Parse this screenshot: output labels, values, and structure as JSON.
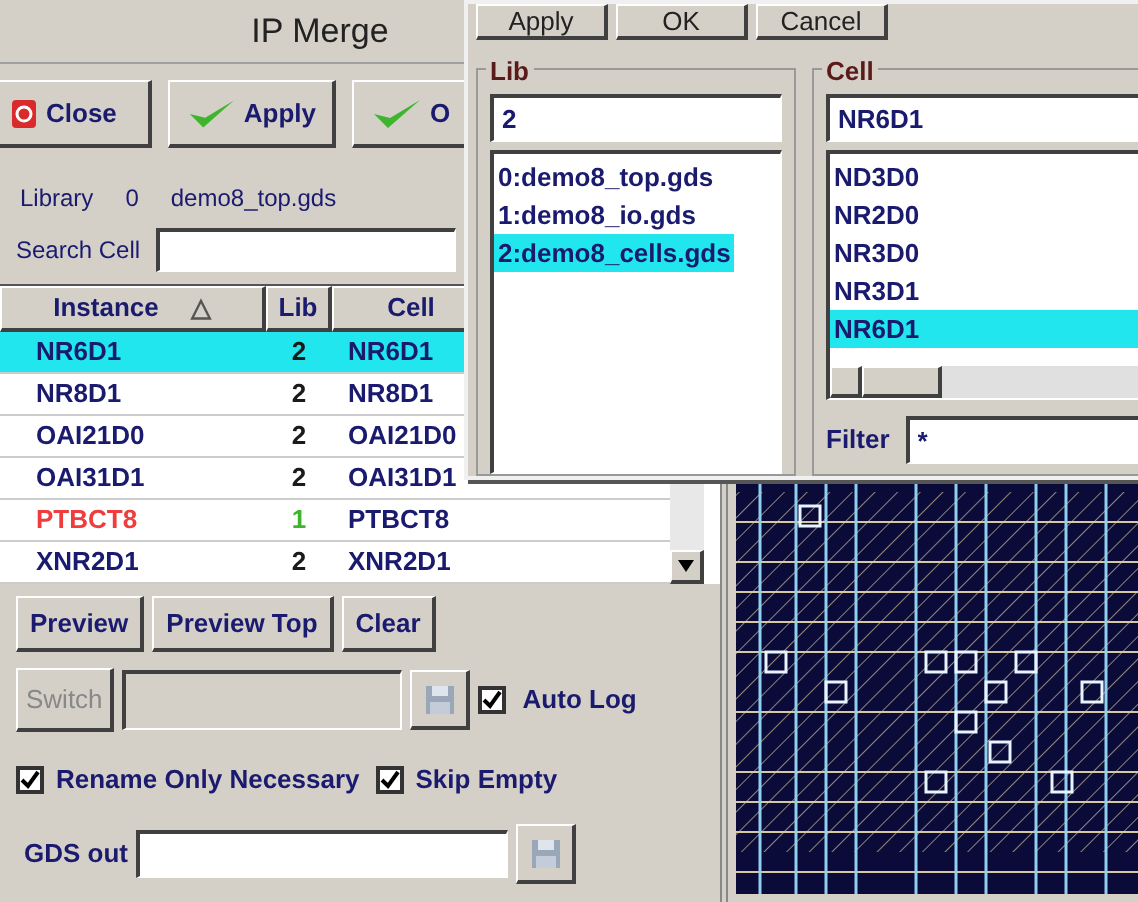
{
  "window": {
    "title": "IP Merge"
  },
  "toolbar": [
    {
      "label": "Close",
      "kind": "close"
    },
    {
      "label": "Apply",
      "kind": "confirm"
    },
    {
      "label": "O",
      "kind": "confirm"
    }
  ],
  "library": {
    "label": "Library",
    "index": "0",
    "file": "demo8_top.gds"
  },
  "search": {
    "label": "Search Cell"
  },
  "table": {
    "columns": [
      {
        "label": "Instance",
        "sort": "△"
      },
      {
        "label": "Lib"
      },
      {
        "label": "Cell"
      }
    ],
    "rows": [
      {
        "instance": "NR6D1",
        "lib": "2",
        "cell": "NR6D1",
        "selected": true,
        "kind": "normal"
      },
      {
        "instance": "NR8D1",
        "lib": "2",
        "cell": "NR8D1",
        "selected": false,
        "kind": "normal"
      },
      {
        "instance": "OAI21D0",
        "lib": "2",
        "cell": "OAI21D0",
        "selected": false,
        "kind": "normal"
      },
      {
        "instance": "OAI31D1",
        "lib": "2",
        "cell": "OAI31D1",
        "selected": false,
        "kind": "normal"
      },
      {
        "instance": "PTBCT8",
        "lib": "1",
        "cell": "PTBCT8",
        "selected": false,
        "kind": "io"
      },
      {
        "instance": "XNR2D1",
        "lib": "2",
        "cell": "XNR2D1",
        "selected": false,
        "kind": "normal"
      }
    ]
  },
  "preview_buttons": [
    "Preview",
    "Preview Top",
    "Clear"
  ],
  "switch": {
    "label": "Switch",
    "disabled": true
  },
  "auto_log": {
    "label": "Auto Log",
    "checked": true
  },
  "options": [
    {
      "label": "Rename Only Necessary",
      "checked": true
    },
    {
      "label": "Skip Empty",
      "checked": true
    }
  ],
  "gds_out": {
    "label": "GDS out"
  },
  "dialog": {
    "buttons": [
      "Apply",
      "OK",
      "Cancel"
    ],
    "lib": {
      "title": "Lib",
      "value": "2",
      "items": [
        {
          "label": "0:demo8_top.gds",
          "selected": false
        },
        {
          "label": "1:demo8_io.gds",
          "selected": false
        },
        {
          "label": "2:demo8_cells.gds",
          "selected": true
        }
      ]
    },
    "cell": {
      "title": "Cell",
      "value": "NR6D1",
      "items": [
        {
          "label": "ND3D0",
          "selected": false
        },
        {
          "label": "NR2D0",
          "selected": false
        },
        {
          "label": "NR3D0",
          "selected": false
        },
        {
          "label": "NR3D1",
          "selected": false
        },
        {
          "label": "NR6D1",
          "selected": true
        }
      ]
    },
    "filter": {
      "label": "Filter",
      "value": "*"
    }
  }
}
